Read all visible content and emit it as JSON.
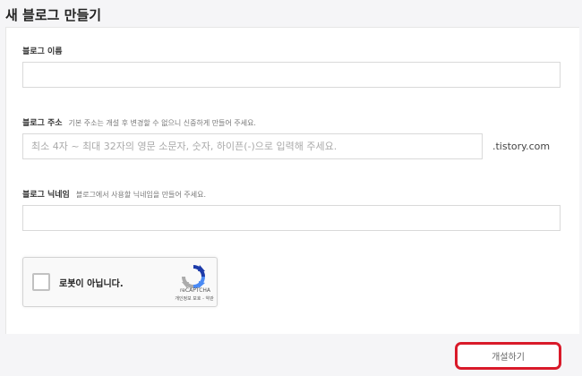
{
  "page": {
    "title": "새 블로그 만들기"
  },
  "form": {
    "name": {
      "label": "블로그 이름",
      "value": "",
      "placeholder": ""
    },
    "address": {
      "label": "블로그 주소",
      "hint": "기본 주소는 개설 후 변경할 수 없으니 신중하게 만들어 주세요.",
      "value": "",
      "placeholder": "최소 4자 ~ 최대 32자의 영문 소문자, 숫자, 하이픈(-)으로 입력해 주세요.",
      "suffix": ".tistory.com"
    },
    "nickname": {
      "label": "블로그 닉네임",
      "hint": "블로그에서 사용할 닉네임을 만들어 주세요.",
      "value": "",
      "placeholder": ""
    }
  },
  "captcha": {
    "text": "로봇이 아닙니다.",
    "brand": "reCAPTCHA",
    "links": "개인정보 보호 - 약관",
    "icon": "recaptcha-icon"
  },
  "footer": {
    "submit_label": "개설하기"
  },
  "colors": {
    "highlight": "#d91a2a"
  }
}
